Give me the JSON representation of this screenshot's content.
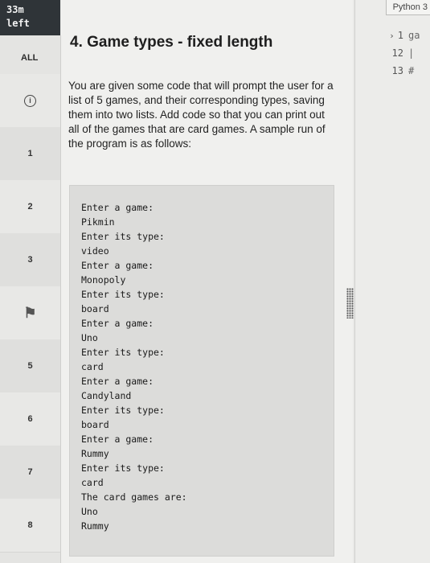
{
  "timer": {
    "value": "33m",
    "suffix": "left"
  },
  "nav": {
    "all_label": "ALL",
    "items": [
      "1",
      "2",
      "3",
      "5",
      "6",
      "7",
      "8"
    ]
  },
  "problem": {
    "title": "4. Game types - fixed length",
    "description": "You are given some code that will prompt the user for a list of 5 games, and their corresponding types, saving them into two lists. Add code so that you can print out all of the games that are card games. A sample run of the program is as follows:",
    "sample_run": [
      "Enter a game:",
      "Pikmin",
      "Enter its type:",
      "video",
      "Enter a game:",
      "Monopoly",
      "Enter its type:",
      "board",
      "Enter a game:",
      "Uno",
      "Enter its type:",
      "card",
      "Enter a game:",
      "Candyland",
      "Enter its type:",
      "board",
      "Enter a game:",
      "Rummy",
      "Enter its type:",
      "card",
      "The card games are:",
      "Uno",
      "Rummy"
    ]
  },
  "editor": {
    "language": "Python 3",
    "line_numbers": [
      "1",
      "12",
      "13"
    ],
    "lines": [
      "ga",
      "|",
      "#"
    ]
  },
  "icons": {
    "info": "info-icon",
    "flag": "flag-icon",
    "grip": "resize-grip-icon",
    "fold": "chevron-right-icon"
  }
}
